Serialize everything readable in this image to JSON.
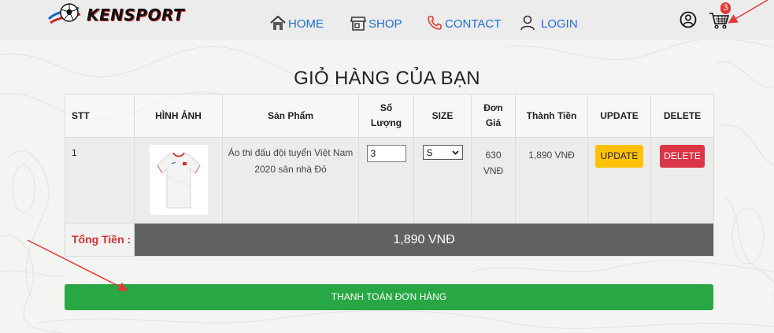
{
  "brand": {
    "name": "KENSPORT",
    "logo_icon": "soccer-ball-logo"
  },
  "nav": {
    "items": [
      {
        "label": "HOME",
        "icon": "home-icon"
      },
      {
        "label": "SHOP",
        "icon": "shop-icon"
      },
      {
        "label": "CONTACT",
        "icon": "phone-icon"
      },
      {
        "label": "LOGIN",
        "icon": "user-icon"
      }
    ],
    "account_icon": "account-circle-icon",
    "cart_icon": "shopping-cart-icon",
    "cart_count": "3"
  },
  "page_title": "GIỎ HÀNG CỦA BẠN",
  "table": {
    "headers": {
      "stt": "STT",
      "image": "HÌNH ẢNH",
      "product": "Sản Phẩm",
      "qty_line1": "Số",
      "qty_line2": "Lượng",
      "size": "SIZE",
      "price_line1": "Đơn",
      "price_line2": "Giá",
      "subtotal": "Thành Tiền",
      "update": "UPDATE",
      "delete": "DELETE"
    },
    "rows": [
      {
        "stt": "1",
        "product_name": "Áo thi đấu đội tuyển Việt Nam 2020 sân nhà Đỏ",
        "quantity": "3",
        "size": "S",
        "price_line1": "630",
        "price_line2": "VNĐ",
        "subtotal": "1,890 VNĐ",
        "update_label": "UPDATE",
        "delete_label": "DELETE"
      }
    ],
    "total_label": "Tổng Tiền :",
    "total_value": "1,890 VNĐ"
  },
  "checkout_label": "THANH TOÁN ĐƠN HÀNG",
  "colors": {
    "nav_link": "#1e6fd9",
    "update_button": "#ffc107",
    "delete_button": "#dc3545",
    "total_bar": "#616161",
    "checkout_button": "#28a745",
    "badge": "#e53935",
    "annotation_arrow": "#e53935"
  }
}
